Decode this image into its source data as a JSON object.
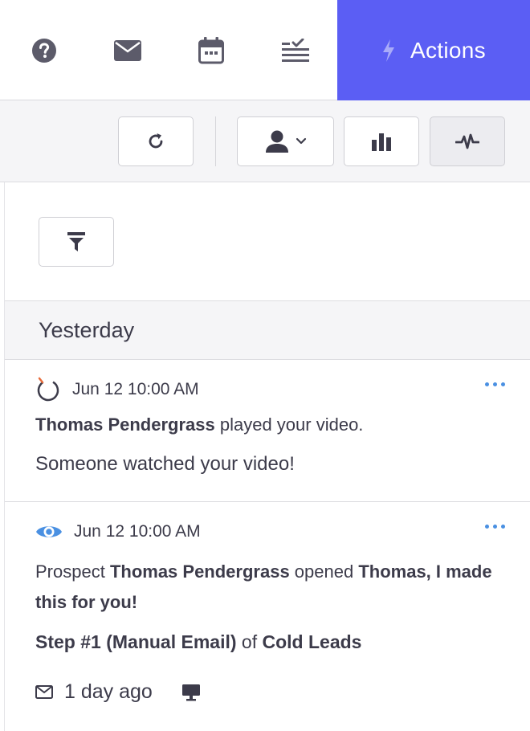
{
  "tabs": {
    "help_icon": "question-circle",
    "mail_icon": "envelope",
    "calendar_icon": "calendar",
    "tasks_icon": "checklist",
    "actions_label": "Actions",
    "actions_icon": "bolt",
    "active_color": "#5b5ef4"
  },
  "toolbar": {
    "refresh_icon": "refresh",
    "person_icon": "person-dropdown",
    "chart_icon": "bar-chart",
    "pulse_icon": "activity-pulse"
  },
  "filter_icon": "funnel",
  "section": {
    "title": "Yesterday"
  },
  "activities": [
    {
      "icon": "video-play",
      "time": "Jun 12 10:00 AM",
      "actor": "Thomas Pendergrass",
      "action": " played your video.",
      "message": "Someone watched your video!"
    },
    {
      "icon": "eye",
      "time": "Jun 12 10:00 AM",
      "prefix": "Prospect ",
      "actor": "Thomas Pendergrass",
      "action": " opened ",
      "subject": "Thomas, I made this for you!",
      "step": "Step #1 (Manual Email)",
      "of": " of ",
      "campaign": "Cold Leads",
      "ago": "1 day ago"
    }
  ]
}
